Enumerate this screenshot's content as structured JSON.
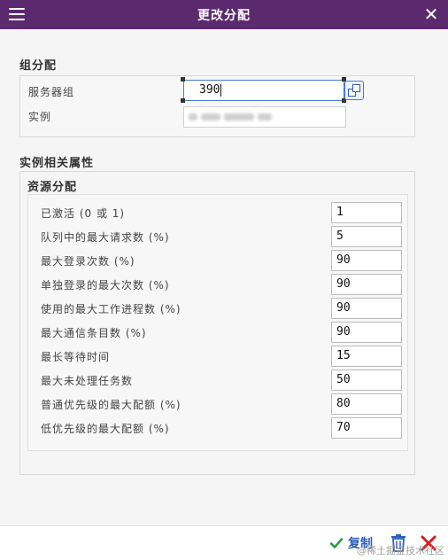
{
  "window": {
    "title": "更改分配",
    "menu_icon": "hamburger-menu-icon",
    "close_icon": "close-icon"
  },
  "group_assignment": {
    "heading": "组分配",
    "server_group_label": "服务器组",
    "server_group_value": "390",
    "instance_label": "实例"
  },
  "instance_properties": {
    "heading": "实例相关属性",
    "resource_heading": "资源分配",
    "fields": [
      {
        "label": "已激活 (0 或 1)",
        "value": "1"
      },
      {
        "label": "队列中的最大请求数 (%)",
        "value": "5"
      },
      {
        "label": "最大登录次数 (%)",
        "value": "90"
      },
      {
        "label": "单独登录的最大次数 (%)",
        "value": "90"
      },
      {
        "label": "使用的最大工作进程数 (%)",
        "value": "90"
      },
      {
        "label": "最大通信条目数 (%)",
        "value": "90"
      },
      {
        "label": "最长等待时间",
        "value": "15"
      },
      {
        "label": "最大未处理任务数",
        "value": "50"
      },
      {
        "label": "普通优先级的最大配额 (%)",
        "value": "80"
      },
      {
        "label": "低优先级的最大配额 (%)",
        "value": "70"
      }
    ]
  },
  "footer": {
    "copy_label": "复制",
    "watermark": "@稀土掘金技术社区"
  },
  "colors": {
    "titlebar": "#5b2a6e",
    "accent_blue": "#2d5fb8",
    "check_green": "#1e9e3a",
    "cancel_red": "#d42020"
  }
}
